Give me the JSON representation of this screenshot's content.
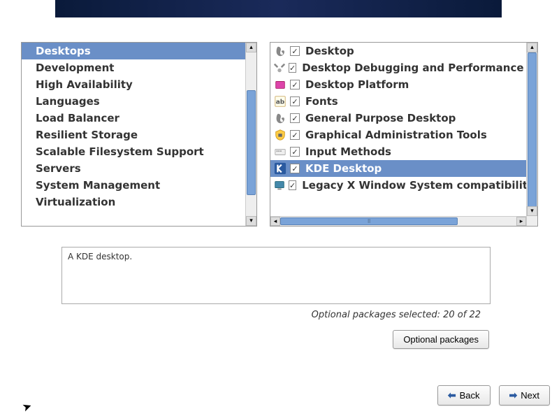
{
  "categories": [
    {
      "label": "Desktops",
      "selected": true
    },
    {
      "label": "Development",
      "selected": false
    },
    {
      "label": "High Availability",
      "selected": false
    },
    {
      "label": "Languages",
      "selected": false
    },
    {
      "label": "Load Balancer",
      "selected": false
    },
    {
      "label": "Resilient Storage",
      "selected": false
    },
    {
      "label": "Scalable Filesystem Support",
      "selected": false
    },
    {
      "label": "Servers",
      "selected": false
    },
    {
      "label": "System Management",
      "selected": false
    },
    {
      "label": "Virtualization",
      "selected": false
    }
  ],
  "packages": [
    {
      "label": "Desktop",
      "checked": true,
      "selected": false,
      "icon": "foot"
    },
    {
      "label": "Desktop Debugging and Performance",
      "checked": true,
      "selected": false,
      "icon": "tools"
    },
    {
      "label": "Desktop Platform",
      "checked": true,
      "selected": false,
      "icon": "box"
    },
    {
      "label": "Fonts",
      "checked": true,
      "selected": false,
      "icon": "font"
    },
    {
      "label": "General Purpose Desktop",
      "checked": true,
      "selected": false,
      "icon": "foot"
    },
    {
      "label": "Graphical Administration Tools",
      "checked": true,
      "selected": false,
      "icon": "shield"
    },
    {
      "label": "Input Methods",
      "checked": true,
      "selected": false,
      "icon": "keyboard"
    },
    {
      "label": "KDE Desktop",
      "checked": true,
      "selected": true,
      "icon": "kde"
    },
    {
      "label": "Legacy X Window System compatibility",
      "checked": true,
      "selected": false,
      "icon": "monitor"
    }
  ],
  "description": "A KDE desktop.",
  "optional_status": "Optional packages selected: 20 of 22",
  "buttons": {
    "optional": "Optional packages",
    "back": "Back",
    "next": "Next"
  },
  "icons": {
    "foot": "<svg viewBox='0 0 20 20'><path d='M7 3c2 0 4 2 4 4s-1 4-1 6 1 3 3 3 2-2 0-4 0-3 2-3 2 3 1 5-3 4-6 4-6-3-6-7 1-8 3-8z' fill='#888'/></svg>",
    "tools": "<svg viewBox='0 0 20 20'><path d='M3 3l5 5-2 2-5-5z M17 3l-5 5 2 2 5-5z' fill='#888'/><circle cx='10' cy='14' r='3' fill='#aaa'/></svg>",
    "box": "<svg viewBox='0 0 20 20'><rect x='3' y='5' width='14' height='11' rx='1' fill='#d4a' stroke='#a26'/></svg>",
    "font": "<svg viewBox='0 0 20 20'><rect x='2' y='2' width='16' height='16' rx='1' fill='#ffe' stroke='#ca6'/><text x='10' y='14' font-size='10' text-anchor='middle' fill='#555'>ab</text></svg>",
    "shield": "<svg viewBox='0 0 20 20'><path d='M10 2l7 3v5c0 5-4 8-7 8s-7-3-7-8V5z' fill='#fc4' stroke='#c92'/><rect x='7' y='8' width='6' height='5' fill='#666'/></svg>",
    "keyboard": "<svg viewBox='0 0 20 20'><rect x='2' y='6' width='16' height='9' rx='1' fill='#eee' stroke='#aaa'/><rect x='4' y='8' width='2' height='2' fill='#999'/><rect x='7' y='8' width='2' height='2' fill='#999'/><rect x='10' y='8' width='2' height='2' fill='#999'/></svg>",
    "kde": "<svg viewBox='0 0 20 20'><rect x='1' y='1' width='18' height='18' rx='2' fill='#2a5aa0'/><path d='M6 4v12M6 10l6-6M6 10l6 6' stroke='#fff' stroke-width='2.5' fill='none'/></svg>",
    "monitor": "<svg viewBox='0 0 20 20'><rect x='3' y='4' width='14' height='10' rx='1' fill='#48a' stroke='#267'/><rect x='7' y='15' width='6' height='2' fill='#888'/></svg>"
  }
}
